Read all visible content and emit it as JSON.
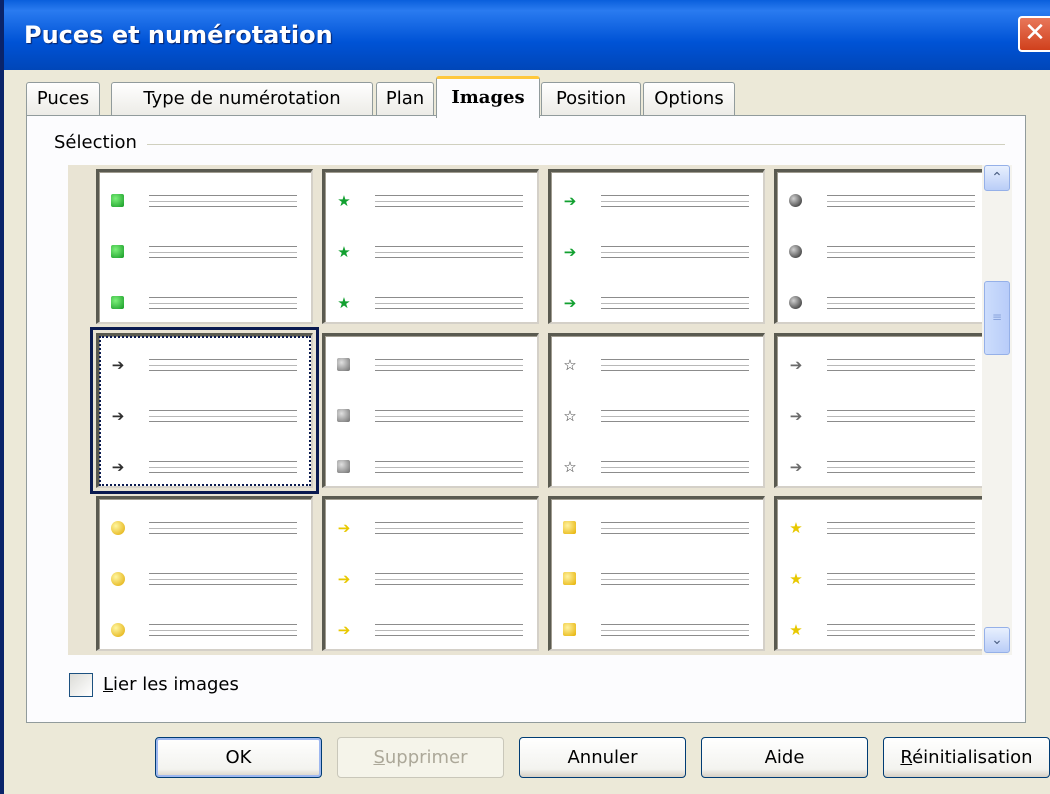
{
  "window": {
    "title": "Puces et numérotation",
    "close_glyph": "✕"
  },
  "tabs": [
    {
      "label": "Puces",
      "active": false
    },
    {
      "label": "Type de numérotation",
      "active": false
    },
    {
      "label": "Plan",
      "active": false
    },
    {
      "label": "Images",
      "active": true
    },
    {
      "label": "Position",
      "active": false
    },
    {
      "label": "Options",
      "active": false
    }
  ],
  "selection": {
    "label": "Sélection",
    "selected_index": 4,
    "cells": [
      {
        "icon": "green-square-bullet"
      },
      {
        "icon": "green-star-bullet"
      },
      {
        "icon": "green-arrow-bullet"
      },
      {
        "icon": "gray-ball-bullet"
      },
      {
        "icon": "black-arrow-bullet"
      },
      {
        "icon": "gray-square-bullet"
      },
      {
        "icon": "black-star-bullet"
      },
      {
        "icon": "gray-arrow-bullet"
      },
      {
        "icon": "yellow-ball-bullet"
      },
      {
        "icon": "yellow-arrow-bullet"
      },
      {
        "icon": "yellow-square-bullet"
      },
      {
        "icon": "yellow-star-bullet"
      }
    ]
  },
  "scrollbar": {
    "up_glyph": "⌃",
    "down_glyph": "⌄",
    "thumb_glyph": "≡"
  },
  "link_images": {
    "label_first": "L",
    "label_rest": "ier les images",
    "checked": false
  },
  "buttons": {
    "ok": "OK",
    "delete_first": "S",
    "delete_rest": "upprimer",
    "cancel": "Annuler",
    "help": "Aide",
    "reset_first": "R",
    "reset_rest": "éinitialisation"
  }
}
